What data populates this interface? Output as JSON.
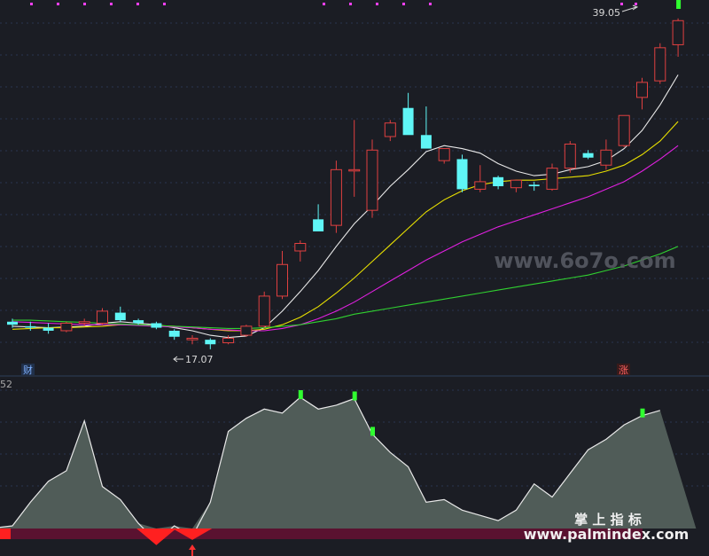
{
  "chart_data": [
    {
      "type": "candlestick",
      "panel": "main",
      "candles": [
        {
          "o": 18.9,
          "h": 19.1,
          "l": 18.5,
          "c": 18.7
        },
        {
          "o": 18.6,
          "h": 18.9,
          "l": 18.3,
          "c": 18.5
        },
        {
          "o": 18.5,
          "h": 18.8,
          "l": 18.1,
          "c": 18.3
        },
        {
          "o": 18.3,
          "h": 18.9,
          "l": 18.2,
          "c": 18.8
        },
        {
          "o": 18.8,
          "h": 19.1,
          "l": 18.6,
          "c": 18.9
        },
        {
          "o": 18.8,
          "h": 19.8,
          "l": 18.7,
          "c": 19.6
        },
        {
          "o": 19.5,
          "h": 19.9,
          "l": 18.9,
          "c": 19.0
        },
        {
          "o": 19.0,
          "h": 19.1,
          "l": 18.7,
          "c": 18.8
        },
        {
          "o": 18.8,
          "h": 18.9,
          "l": 18.4,
          "c": 18.5
        },
        {
          "o": 18.3,
          "h": 18.4,
          "l": 17.7,
          "c": 17.9
        },
        {
          "o": 17.7,
          "h": 18.0,
          "l": 17.4,
          "c": 17.8
        },
        {
          "o": 17.7,
          "h": 17.8,
          "l": 17.07,
          "c": 17.4
        },
        {
          "o": 17.5,
          "h": 18.0,
          "l": 17.4,
          "c": 17.8
        },
        {
          "o": 18.0,
          "h": 18.7,
          "l": 17.9,
          "c": 18.6
        },
        {
          "o": 18.6,
          "h": 20.9,
          "l": 18.5,
          "c": 20.6
        },
        {
          "o": 20.6,
          "h": 23.6,
          "l": 20.4,
          "c": 22.7
        },
        {
          "o": 23.6,
          "h": 24.3,
          "l": 22.9,
          "c": 24.1
        },
        {
          "o": 25.7,
          "h": 26.7,
          "l": 25.3,
          "c": 24.9
        },
        {
          "o": 25.3,
          "h": 29.6,
          "l": 24.8,
          "c": 29.0
        },
        {
          "o": 29.0,
          "h": 32.3,
          "l": 27.2,
          "c": 29.0
        },
        {
          "o": 26.3,
          "h": 31.0,
          "l": 25.8,
          "c": 30.3
        },
        {
          "o": 31.2,
          "h": 32.3,
          "l": 30.9,
          "c": 32.1
        },
        {
          "o": 33.1,
          "h": 34.1,
          "l": 31.8,
          "c": 31.3
        },
        {
          "o": 31.3,
          "h": 33.2,
          "l": 30.6,
          "c": 30.4
        },
        {
          "o": 29.6,
          "h": 30.4,
          "l": 29.4,
          "c": 30.4
        },
        {
          "o": 29.7,
          "h": 30.0,
          "l": 27.5,
          "c": 27.7
        },
        {
          "o": 27.7,
          "h": 29.3,
          "l": 27.5,
          "c": 28.2
        },
        {
          "o": 28.5,
          "h": 28.6,
          "l": 27.7,
          "c": 27.9
        },
        {
          "o": 27.8,
          "h": 28.3,
          "l": 27.5,
          "c": 28.3
        },
        {
          "o": 28.0,
          "h": 28.2,
          "l": 27.6,
          "c": 27.9
        },
        {
          "o": 27.7,
          "h": 29.4,
          "l": 27.6,
          "c": 29.1
        },
        {
          "o": 29.1,
          "h": 30.9,
          "l": 28.8,
          "c": 30.7
        },
        {
          "o": 30.1,
          "h": 30.3,
          "l": 29.7,
          "c": 29.8
        },
        {
          "o": 29.3,
          "h": 31.0,
          "l": 29.0,
          "c": 30.3
        },
        {
          "o": 30.6,
          "h": 32.6,
          "l": 30.5,
          "c": 32.6
        },
        {
          "o": 33.8,
          "h": 35.1,
          "l": 33.0,
          "c": 34.8
        },
        {
          "o": 34.9,
          "h": 37.4,
          "l": 34.7,
          "c": 37.1
        },
        {
          "o": 37.3,
          "h": 39.05,
          "l": 36.5,
          "c": 38.9
        }
      ],
      "ma": [
        {
          "color": "#e8e8e8",
          "values": [
            18.6,
            18.55,
            18.5,
            18.55,
            18.6,
            18.8,
            18.9,
            18.8,
            18.7,
            18.5,
            18.3,
            18.0,
            17.85,
            17.95,
            18.5,
            19.6,
            20.9,
            22.3,
            23.9,
            25.4,
            26.6,
            27.9,
            29.0,
            30.2,
            30.6,
            30.4,
            30.1,
            29.4,
            28.9,
            28.6,
            28.7,
            29.0,
            29.2,
            29.6,
            30.4,
            31.6,
            33.3,
            35.3
          ]
        },
        {
          "color": "#e8e000",
          "values": [
            18.4,
            18.45,
            18.5,
            18.5,
            18.55,
            18.6,
            18.7,
            18.7,
            18.65,
            18.6,
            18.5,
            18.4,
            18.3,
            18.3,
            18.4,
            18.7,
            19.2,
            19.9,
            20.8,
            21.8,
            22.9,
            24.0,
            25.1,
            26.2,
            27.0,
            27.6,
            28.0,
            28.2,
            28.3,
            28.3,
            28.4,
            28.5,
            28.6,
            28.9,
            29.3,
            30.0,
            30.9,
            32.2
          ]
        },
        {
          "color": "#e020e0",
          "values": [
            18.9,
            18.85,
            18.8,
            18.75,
            18.7,
            18.7,
            18.7,
            18.65,
            18.6,
            18.55,
            18.5,
            18.4,
            18.35,
            18.3,
            18.3,
            18.45,
            18.7,
            19.1,
            19.6,
            20.2,
            20.9,
            21.6,
            22.3,
            23.0,
            23.6,
            24.2,
            24.7,
            25.2,
            25.6,
            26.0,
            26.4,
            26.8,
            27.2,
            27.7,
            28.2,
            28.9,
            29.7,
            30.6
          ]
        },
        {
          "color": "#30d030",
          "values": [
            19.0,
            19.0,
            18.95,
            18.9,
            18.85,
            18.8,
            18.75,
            18.7,
            18.65,
            18.6,
            18.55,
            18.5,
            18.45,
            18.45,
            18.5,
            18.6,
            18.7,
            18.9,
            19.1,
            19.4,
            19.6,
            19.8,
            20.0,
            20.2,
            20.4,
            20.6,
            20.8,
            21.0,
            21.2,
            21.4,
            21.6,
            21.8,
            22.0,
            22.3,
            22.6,
            23.0,
            23.4,
            23.9
          ]
        }
      ],
      "annotations": {
        "high": "39.05",
        "low": "17.07",
        "left_marker": "财",
        "right_marker": "涨"
      },
      "ylim": [
        16.0,
        39.8
      ]
    },
    {
      "type": "area",
      "panel": "indicator",
      "label": "52",
      "x": [
        -1,
        0,
        1,
        2,
        3,
        4,
        5,
        6,
        7,
        8,
        9,
        10,
        11,
        12,
        13,
        14,
        15,
        16,
        17,
        18,
        19,
        20,
        21,
        22,
        23,
        24,
        25,
        26,
        27,
        28,
        29,
        30,
        31,
        32,
        33,
        34,
        35,
        36,
        37,
        38
      ],
      "values": [
        0.5,
        2,
        20,
        36,
        44,
        82,
        32,
        22,
        4,
        -10,
        2,
        -6,
        20,
        74,
        84,
        91,
        88,
        100,
        91,
        94,
        99,
        72,
        58,
        47,
        20,
        22,
        14,
        10,
        6,
        14,
        34,
        24,
        42,
        60,
        68,
        79,
        86,
        90
      ],
      "ylim": [
        -15,
        105
      ]
    }
  ],
  "watermarks": {
    "site1": "www.6o7o.com",
    "brand": "掌 上 指 标",
    "site2": "www.palmindex.com"
  },
  "colors": {
    "bg": "#1b1d24",
    "up": "#e04040",
    "down": "#5ff6f6",
    "area": "#505c58"
  }
}
